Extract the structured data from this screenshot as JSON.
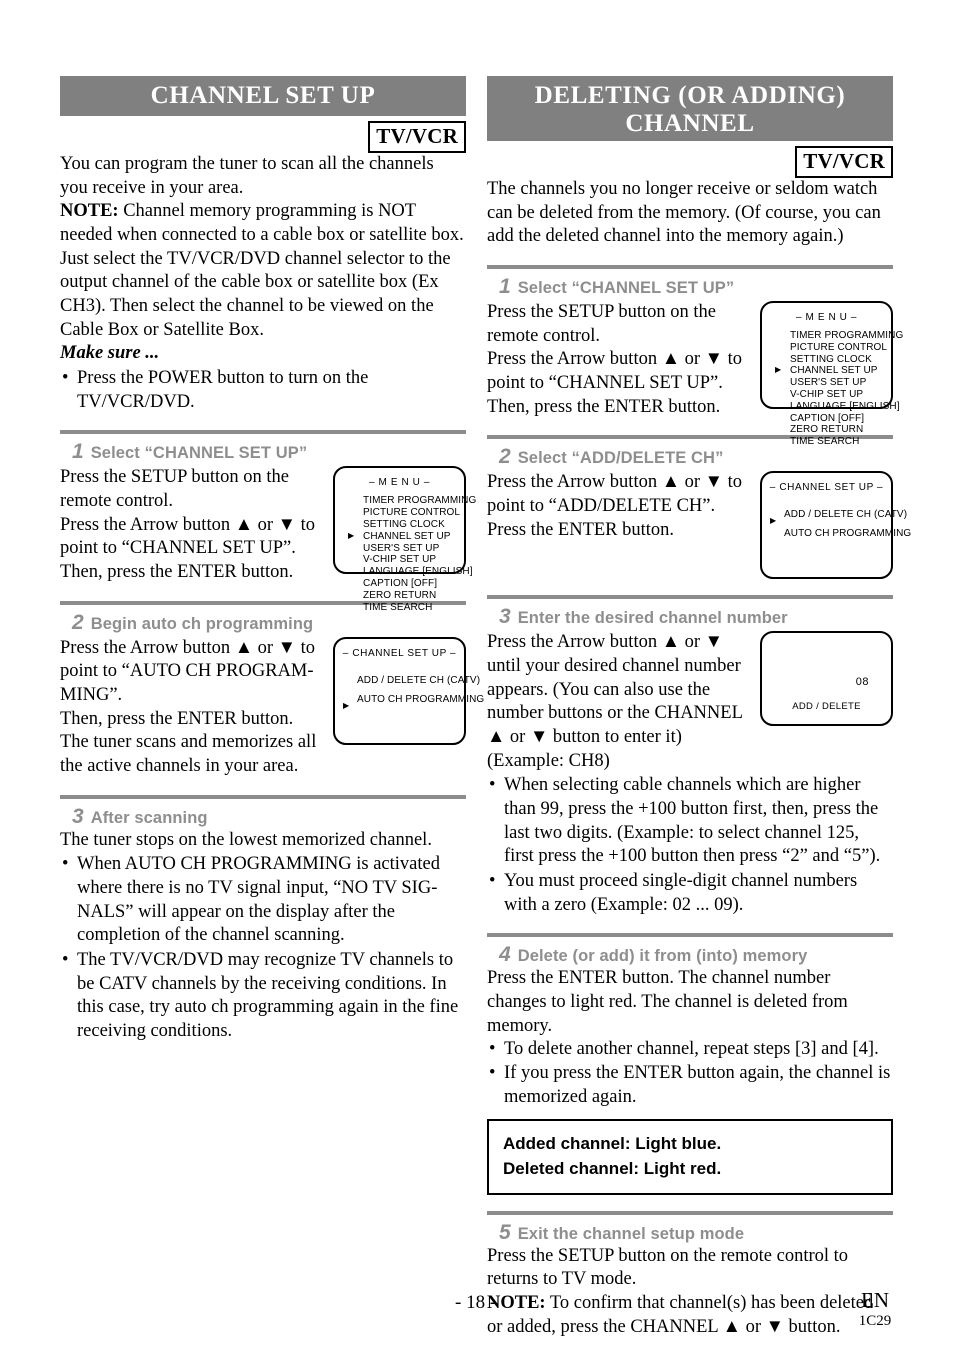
{
  "left": {
    "header_title": "CHANNEL SET UP",
    "badge": "TV/VCR",
    "intro_1": "You can program the tuner to scan all the channels you receive in your area.",
    "note_label": "NOTE:",
    "note_text": " Channel memory programming is NOT needed when connected to a cable box or satellite box. Just select the TV/VCR/DVD channel selector to the output channel of the cable box or satellite box (Ex CH3). Then select the channel to be viewed on the Cable Box or Satellite Box.",
    "make_sure": "Make sure ...",
    "make_sure_bullet": "Press the POWER button to turn on the TV/VCR/DVD.",
    "step1": {
      "num": "1",
      "title": "Select “CHANNEL SET UP”",
      "p1": "Press the SETUP button on the remote control.",
      "p2": "Press the Arrow button ▲ or ▼ to point to “CHANNEL SET UP”.",
      "p3": "Then, press the ENTER button.",
      "osd": {
        "title": "– M E N U –",
        "items": [
          "TIMER PROGRAMMING",
          "PICTURE CONTROL",
          "SETTING CLOCK",
          "CHANNEL SET UP",
          "USER'S SET UP",
          "V-CHIP SET UP",
          "LANGUAGE  [ENGLISH]",
          "CAPTION  [OFF]",
          "ZERO RETURN",
          "TIME SEARCH"
        ],
        "selected_index": 3
      }
    },
    "step2": {
      "num": "2",
      "title": "Begin auto ch programming",
      "p1": "Press the Arrow button ▲ or ▼ to point to “AUTO CH PROGRAM-MING”.",
      "p2": "Then, press the ENTER button.",
      "p3": "The tuner scans and memorizes all the active channels in your area.",
      "osd": {
        "title": "– CHANNEL SET UP –",
        "items": [
          "ADD / DELETE CH (CATV)",
          "AUTO CH PROGRAMMING"
        ],
        "selected_index": 1
      }
    },
    "step3": {
      "num": "3",
      "title": "After scanning",
      "p1": "The tuner stops on the lowest memorized channel.",
      "bullets": [
        "When AUTO CH PROGRAMMING is activated where there is no TV signal input, “NO TV SIG-NALS” will appear on the display after the completion of the channel scanning.",
        "The TV/VCR/DVD may recognize TV channels to be CATV channels by the receiving conditions. In this case, try auto ch programming again in the fine receiving conditions."
      ]
    }
  },
  "right": {
    "header_title_line1": "DELETING (OR ADDING)",
    "header_title_line2": "CHANNEL",
    "badge": "TV/VCR",
    "intro_1": "The channels you no longer receive or seldom watch can be deleted from the memory. (Of course, you can add the deleted channel into the memory again.)",
    "step1": {
      "num": "1",
      "title": "Select “CHANNEL SET UP”",
      "p1": "Press the SETUP button on the remote control.",
      "p2": "Press the Arrow button ▲ or ▼ to point to “CHANNEL SET UP”.",
      "p3": "Then, press the ENTER button.",
      "osd": {
        "title": "– M E N U –",
        "items": [
          "TIMER PROGRAMMING",
          "PICTURE CONTROL",
          "SETTING CLOCK",
          "CHANNEL SET UP",
          "USER'S SET UP",
          "V-CHIP SET UP",
          "LANGUAGE  [ENGLISH]",
          "CAPTION  [OFF]",
          "ZERO RETURN",
          "TIME SEARCH"
        ],
        "selected_index": 3
      }
    },
    "step2": {
      "num": "2",
      "title": "Select “ADD/DELETE CH”",
      "p1": "Press the Arrow button ▲ or ▼ to point to “ADD/DELETE CH”.",
      "p2": "Press the ENTER button.",
      "osd": {
        "title": "– CHANNEL SET UP –",
        "items": [
          "ADD / DELETE CH (CATV)",
          "AUTO CH PROGRAMMING"
        ],
        "selected_index": 0
      }
    },
    "step3": {
      "num": "3",
      "title": "Enter the desired channel number",
      "p1": "Press the Arrow button ▲ or ▼ until your desired channel number appears. (You can also use the number buttons or the CHANNEL ▲ or ▼ button to enter it) (Example: CH8)",
      "bullets": [
        "When selecting cable channels which are higher than 99, press the +100 button first, then, press the last two digits. (Example: to select channel 125, first press the +100 button then press “2” and “5”).",
        "You must proceed single-digit channel numbers with a zero (Example: 02 ...  09)."
      ],
      "osd": {
        "channel": "08",
        "label": "ADD / DELETE"
      }
    },
    "step4": {
      "num": "4",
      "title": "Delete (or add) it from (into) memory",
      "p1": "Press the ENTER button. The channel number changes to light red. The channel is deleted from memory.",
      "bullets": [
        "To delete another channel, repeat steps [3] and [4].",
        "If you press the ENTER button again, the channel is memorized again."
      ],
      "callout_line1": "Added channel: Light blue.",
      "callout_line2": "Deleted channel: Light red."
    },
    "step5": {
      "num": "5",
      "title": "Exit the channel setup mode",
      "p1": "Press the SETUP button on the remote control to returns to TV mode.",
      "note_label": "NOTE:",
      "note_text": " To confirm that channel(s) has been deleted or added, press the CHANNEL ▲ or ▼ button."
    }
  },
  "footer": {
    "page_number": "- 18 -",
    "language": "EN",
    "code": "1C29"
  },
  "colors": {
    "header_bar": "#808080",
    "step_label": "#8e8e8e",
    "rule": "#8c8c8c"
  }
}
